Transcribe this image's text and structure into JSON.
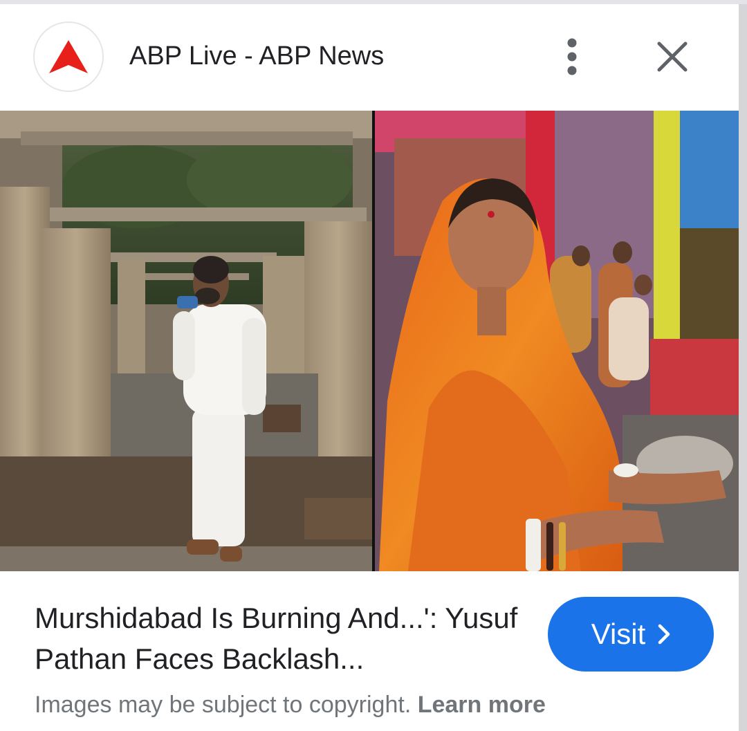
{
  "source": {
    "title": "ABP Live - ABP News",
    "favicon_icon": "abp-red-triangle-logo",
    "brand_color": "#e8201c"
  },
  "header_icons": {
    "more": "more-vert-icon",
    "close": "close-icon"
  },
  "image_preview": {
    "lens_icon": "google-lens-icon"
  },
  "result": {
    "title": "Murshidabad Is Burning And...': Yusuf Pathan Faces Backlash...",
    "visit_label": "Visit",
    "visit_icon": "chevron-right-icon",
    "visit_color": "#1a73e8"
  },
  "footer": {
    "copyright_text": "Images may be subject to copyright.",
    "learn_more_label": "Learn more"
  }
}
